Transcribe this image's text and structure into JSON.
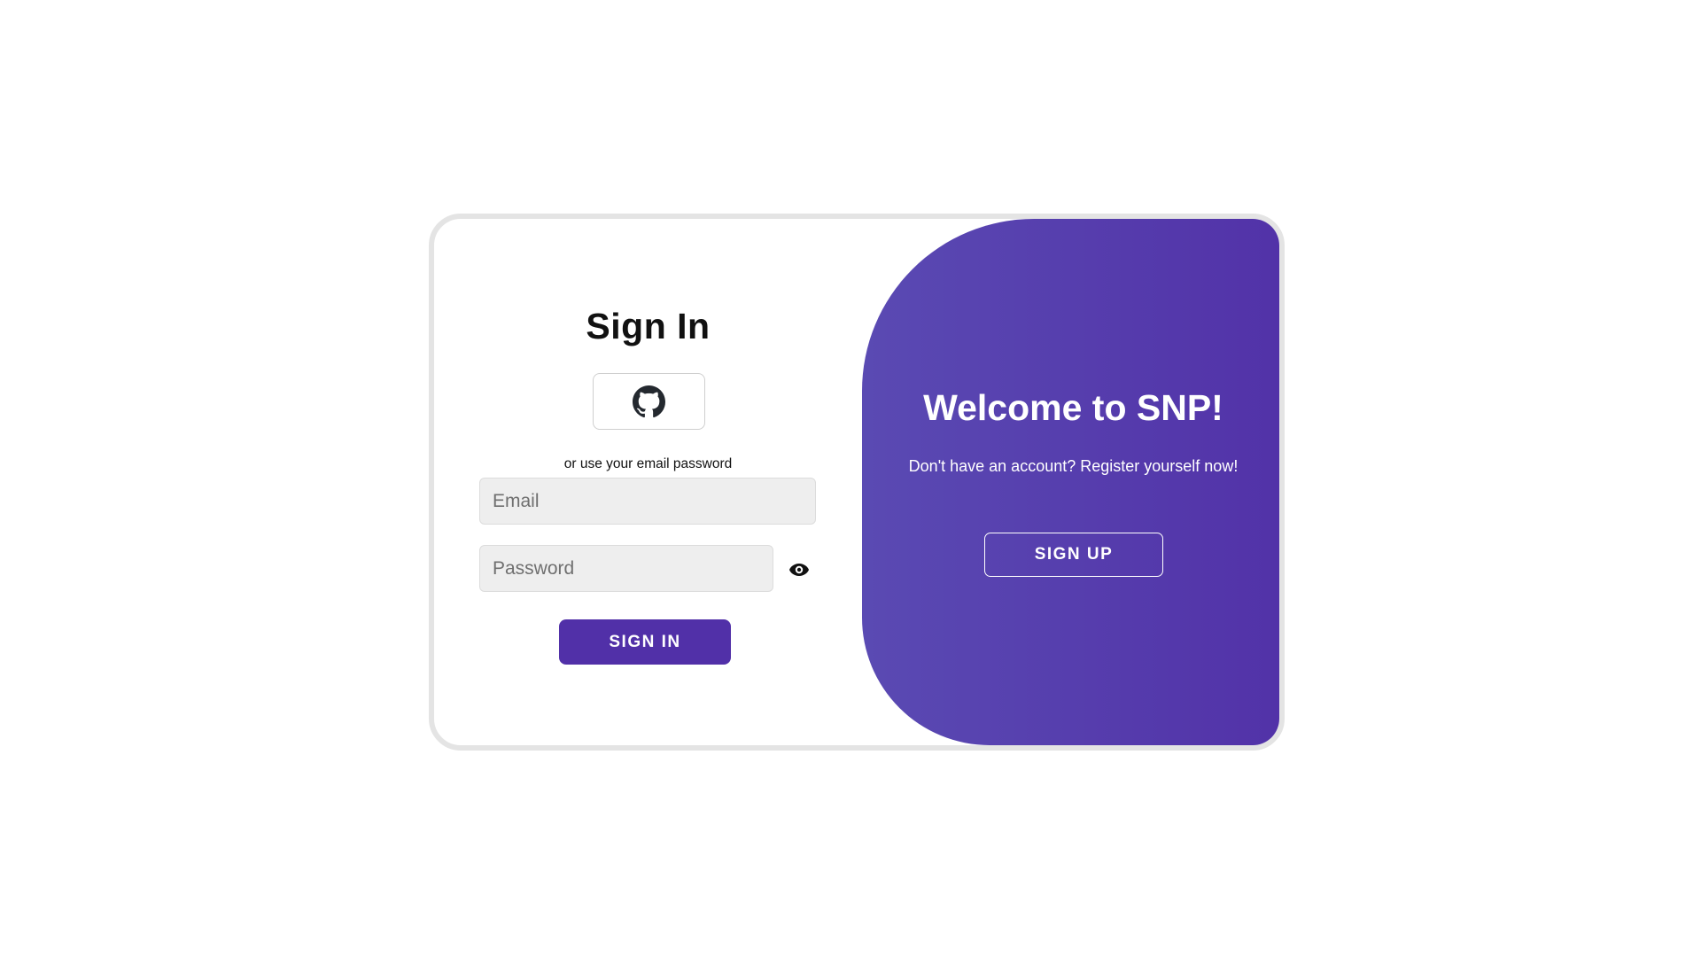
{
  "signin": {
    "title": "Sign In",
    "github_icon": "github-icon",
    "hint": "or use your email password",
    "email_placeholder": "Email",
    "email_value": "",
    "password_placeholder": "Password",
    "password_value": "",
    "eye_icon": "eye-icon",
    "button_label": "SIGN IN"
  },
  "welcome_panel": {
    "title": "Welcome to SNP!",
    "subtitle": "Don't have an account? Register yourself now!",
    "button_label": "SIGN UP"
  },
  "colors": {
    "accent": "#5130a8",
    "panel_gradient_start": "#5a4ab3",
    "panel_gradient_end": "#5232a8",
    "input_bg": "#eeeeee",
    "card_border": "#e4e4e4"
  }
}
